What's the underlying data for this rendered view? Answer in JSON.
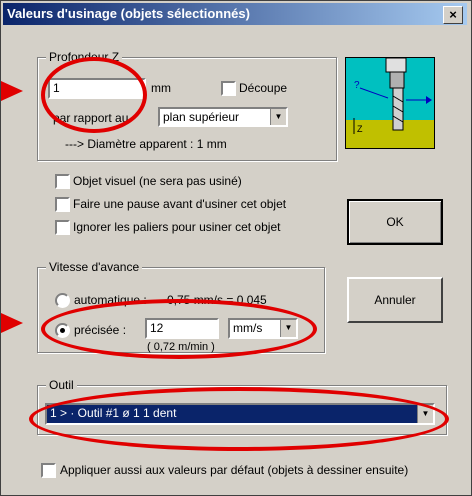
{
  "title": "Valeurs d'usinage (objets sélectionnés)",
  "close_label": "×",
  "profondeur": {
    "legend": "Profondeur Z",
    "value": "1",
    "unit": "mm",
    "decoupe_label": "Découpe",
    "par_rapport_label": "par rapport au",
    "reference_selected": "plan supérieur",
    "diametre_text": "---> Diamètre apparent : 1 mm"
  },
  "options": {
    "objet_visuel": "Objet visuel  (ne sera pas usiné)",
    "pause": "Faire une pause avant d'usiner cet objet",
    "ignorer_paliers": "Ignorer les paliers pour usiner cet objet"
  },
  "vitesse": {
    "legend": "Vitesse d'avance",
    "auto_label": "automatique :",
    "auto_value": "0,75 mm/s  = 0,045",
    "precisee_label": "précisée :",
    "precisee_value": "12",
    "unit_selected": "mm/s",
    "conversion": "( 0,72 m/min )"
  },
  "outil": {
    "legend": "Outil",
    "selected": "1 > · Outil #1   ø 1   1 dent"
  },
  "buttons": {
    "ok": "OK",
    "annuler": "Annuler"
  },
  "appliquer_label": "Appliquer aussi aux valeurs par défaut  (objets à dessiner ensuite)",
  "diagram_labels": {
    "z": "Z"
  },
  "colors": {
    "annotation_red": "#e00000",
    "selection_blue": "#0a246a",
    "diagram_bg": "#00c0c0",
    "diagram_surface": "#c0c000"
  }
}
